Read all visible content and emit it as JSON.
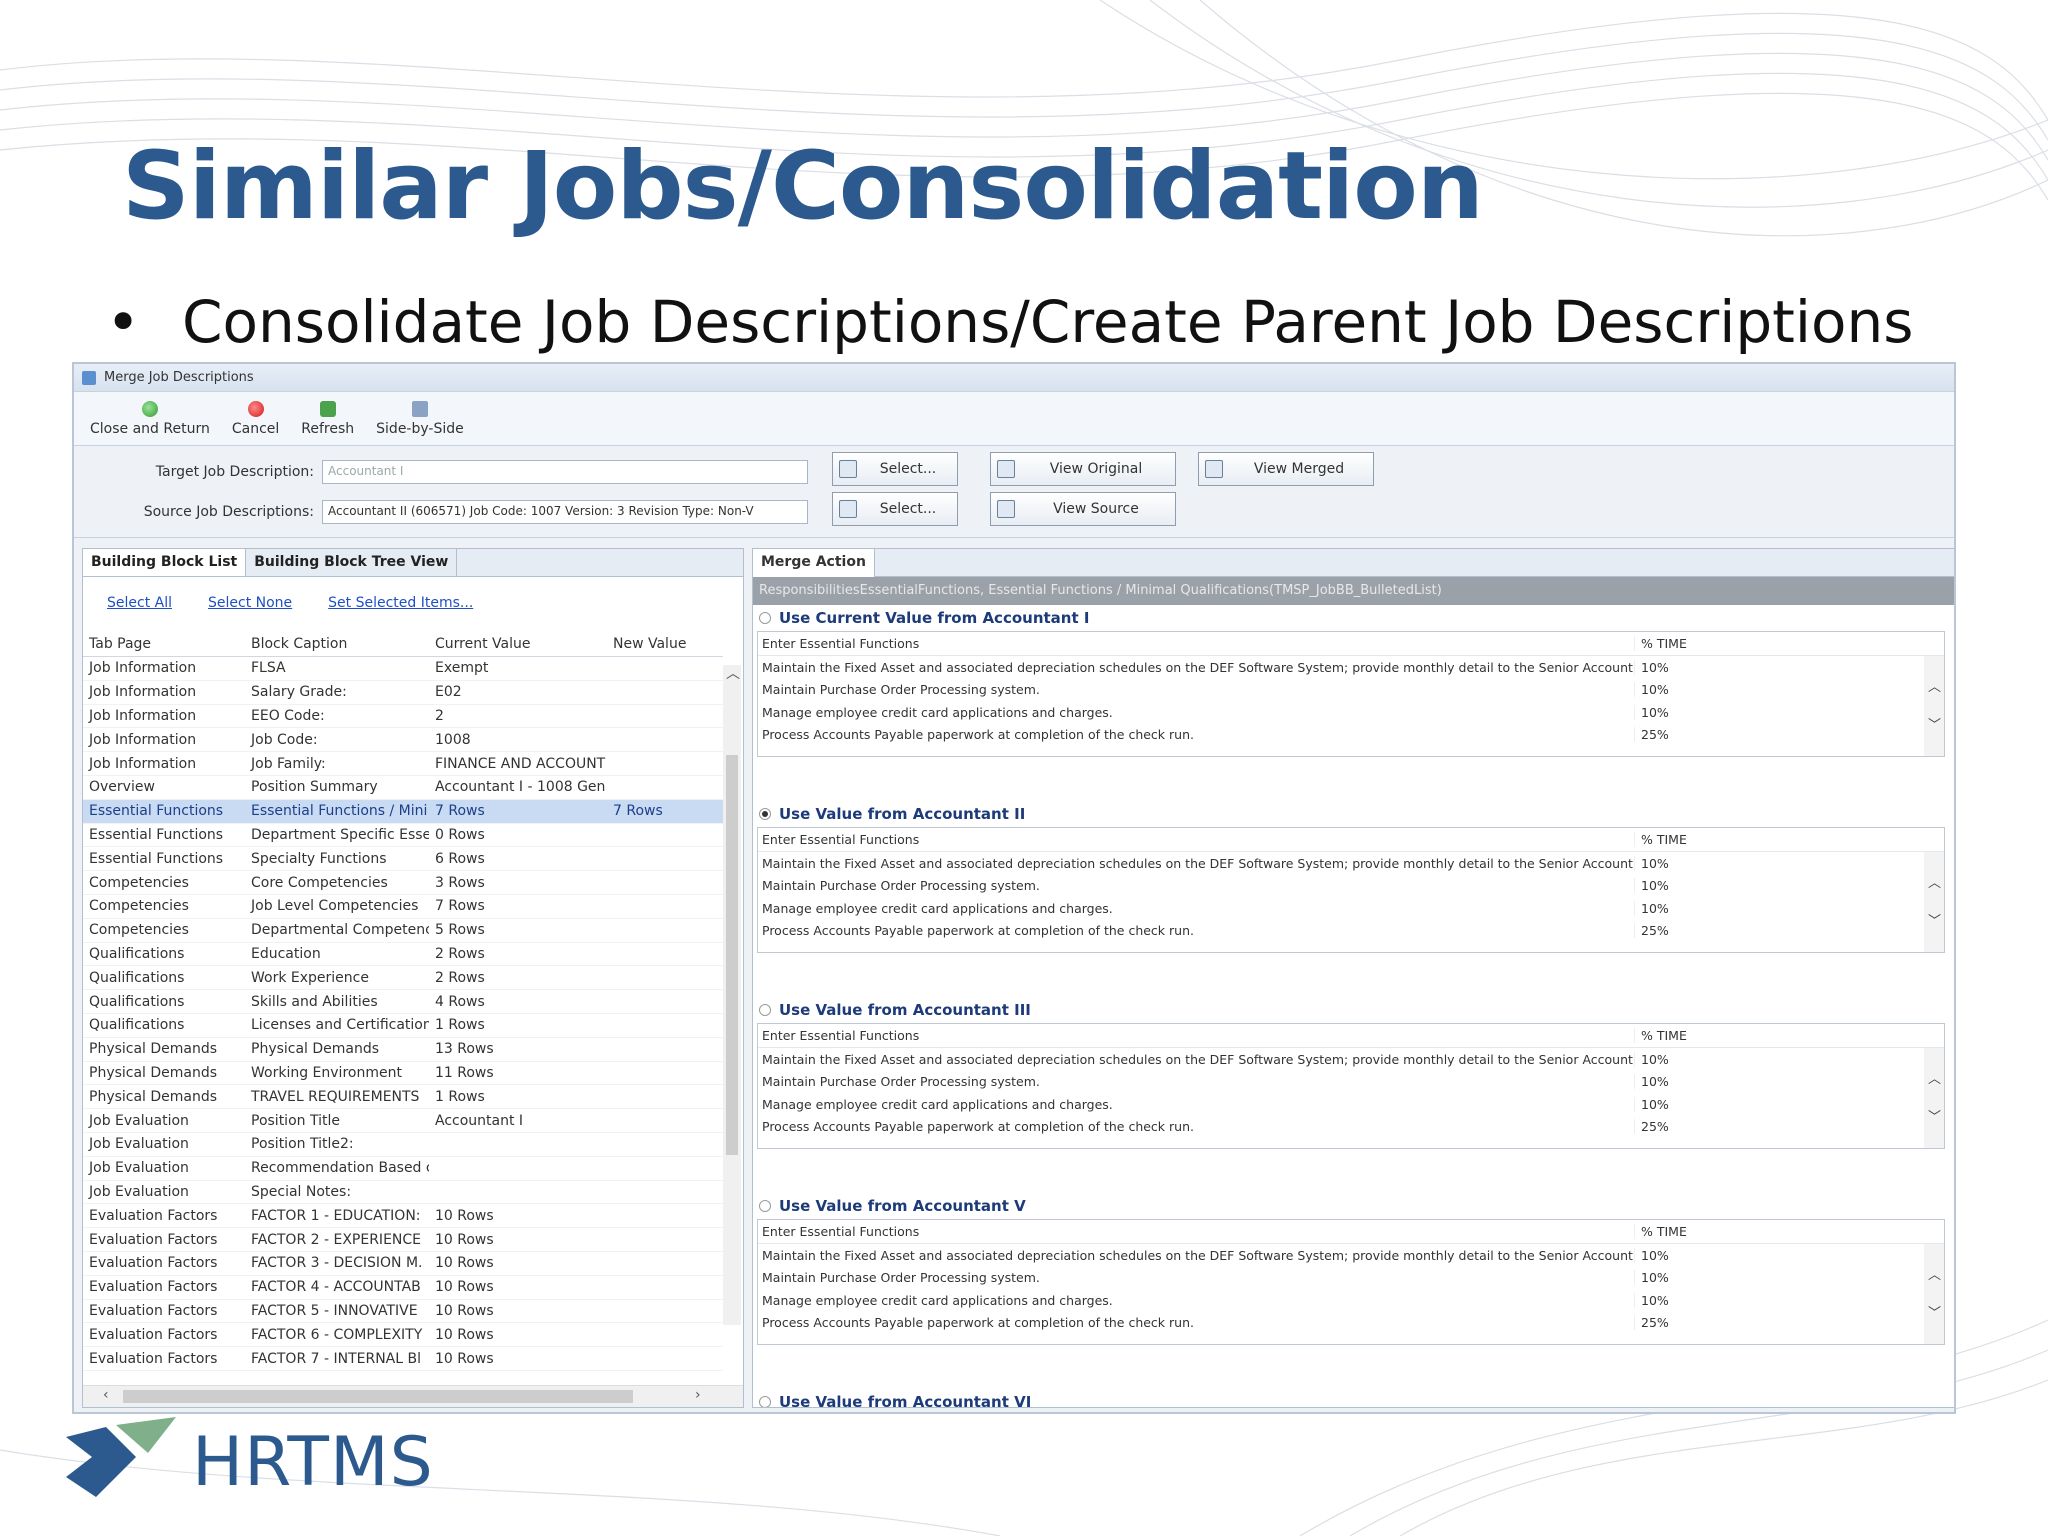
{
  "slide": {
    "title": "Similar Jobs/Consolidation",
    "bullet": "Consolidate Job Descriptions/Create Parent Job Descriptions",
    "logo_text": "HRTMS"
  },
  "colors": {
    "title": "#2c5a8f",
    "selected_row": "#c9dbf3",
    "link": "#1d4fc4",
    "path_bar": "#9aa1a9"
  },
  "window": {
    "title": "Merge Job Descriptions",
    "toolbar": [
      {
        "label": "Close and Return",
        "icon": "check-icon"
      },
      {
        "label": "Cancel",
        "icon": "cancel-icon"
      },
      {
        "label": "Refresh",
        "icon": "refresh-icon"
      },
      {
        "label": "Side-by-Side",
        "icon": "side-by-side-icon"
      }
    ],
    "form": {
      "target_label": "Target Job Description:",
      "target_placeholder": "Accountant I",
      "source_label": "Source Job Descriptions:",
      "source_value": "Accountant II (606571) Job Code: 1007  Version: 3 Revision Type: Non-V",
      "select_label": "Select...",
      "view_original": "View Original",
      "view_merged": "View Merged",
      "view_source": "View Source"
    },
    "left": {
      "tabs": [
        "Building Block List",
        "Building Block Tree View"
      ],
      "links": [
        "Select All",
        "Select None",
        "Set Selected Items..."
      ],
      "columns": [
        "Tab Page",
        "Block Caption",
        "Current Value",
        "New Value"
      ],
      "rows": [
        [
          "Job Information",
          "FLSA",
          "Exempt",
          ""
        ],
        [
          "Job Information",
          "Salary Grade:",
          "E02",
          ""
        ],
        [
          "Job Information",
          "EEO Code:",
          "2",
          ""
        ],
        [
          "Job Information",
          "Job Code:",
          "1008",
          ""
        ],
        [
          "Job Information",
          "Job Family:",
          "FINANCE AND ACCOUNT",
          ""
        ],
        [
          "Overview",
          "Position Summary",
          "Accountant I - 1008 Gen",
          ""
        ],
        [
          "Essential Functions",
          "Essential Functions / Mini",
          "7 Rows",
          "7 Rows"
        ],
        [
          "Essential Functions",
          "Department Specific Esse",
          "0 Rows",
          ""
        ],
        [
          "Essential Functions",
          "Specialty Functions",
          "6 Rows",
          ""
        ],
        [
          "Competencies",
          "Core Competencies",
          "3 Rows",
          ""
        ],
        [
          "Competencies",
          "Job Level Competencies",
          "7 Rows",
          ""
        ],
        [
          "Competencies",
          "Departmental Competenc",
          "5 Rows",
          ""
        ],
        [
          "Qualifications",
          "Education",
          "2 Rows",
          ""
        ],
        [
          "Qualifications",
          "Work Experience",
          "2 Rows",
          ""
        ],
        [
          "Qualifications",
          "Skills and Abilities",
          "4 Rows",
          ""
        ],
        [
          "Qualifications",
          "Licenses and Certification",
          "1 Rows",
          ""
        ],
        [
          "Physical Demands",
          "Physical Demands",
          "13 Rows",
          ""
        ],
        [
          "Physical Demands",
          "Working Environment",
          "11 Rows",
          ""
        ],
        [
          "Physical Demands",
          "TRAVEL REQUIREMENTS",
          "1 Rows",
          ""
        ],
        [
          "Job Evaluation",
          "Position Title",
          "Accountant I",
          ""
        ],
        [
          "Job Evaluation",
          "Position Title2:",
          "",
          ""
        ],
        [
          "Job Evaluation",
          "Recommendation Based c",
          "",
          ""
        ],
        [
          "Job Evaluation",
          "Special Notes:",
          "",
          ""
        ],
        [
          "Evaluation Factors",
          "FACTOR 1 - EDUCATION:",
          "10 Rows",
          ""
        ],
        [
          "Evaluation Factors",
          "FACTOR 2 - EXPERIENCE",
          "10 Rows",
          ""
        ],
        [
          "Evaluation Factors",
          "FACTOR 3 - DECISION M.",
          "10 Rows",
          ""
        ],
        [
          "Evaluation Factors",
          "FACTOR 4 - ACCOUNTAB",
          "10 Rows",
          ""
        ],
        [
          "Evaluation Factors",
          "FACTOR 5 - INNOVATIVE",
          "10 Rows",
          ""
        ],
        [
          "Evaluation Factors",
          "FACTOR 6 - COMPLEXITY",
          "10 Rows",
          ""
        ],
        [
          "Evaluation Factors",
          "FACTOR 7 - INTERNAL Bl",
          "10 Rows",
          ""
        ]
      ],
      "selected_row": 6
    },
    "right": {
      "tab": "Merge Action",
      "path": "ResponsibilitiesEssentialFunctions, Essential Functions / Minimal Qualifications(TMSP_JobBB_BulletedList)",
      "sub_headers": [
        "Enter Essential Functions",
        "% TIME"
      ],
      "sub_rows": [
        [
          "Maintain the Fixed Asset and associated depreciation schedules on the DEF Software System; provide monthly detail to the Senior Account",
          "10%"
        ],
        [
          "Maintain Purchase Order Processing system.",
          "10%"
        ],
        [
          "Manage employee credit card applications and charges.",
          "10%"
        ],
        [
          "Process Accounts Payable paperwork at completion of the check run.",
          "25%"
        ]
      ],
      "options": [
        {
          "label": "Use Current Value from Accountant I",
          "selected": false
        },
        {
          "label": "Use Value from Accountant II",
          "selected": true
        },
        {
          "label": "Use Value from Accountant III",
          "selected": false
        },
        {
          "label": "Use Value from Accountant V",
          "selected": false
        },
        {
          "label": "Use Value from Accountant VI",
          "selected": false
        }
      ]
    }
  }
}
